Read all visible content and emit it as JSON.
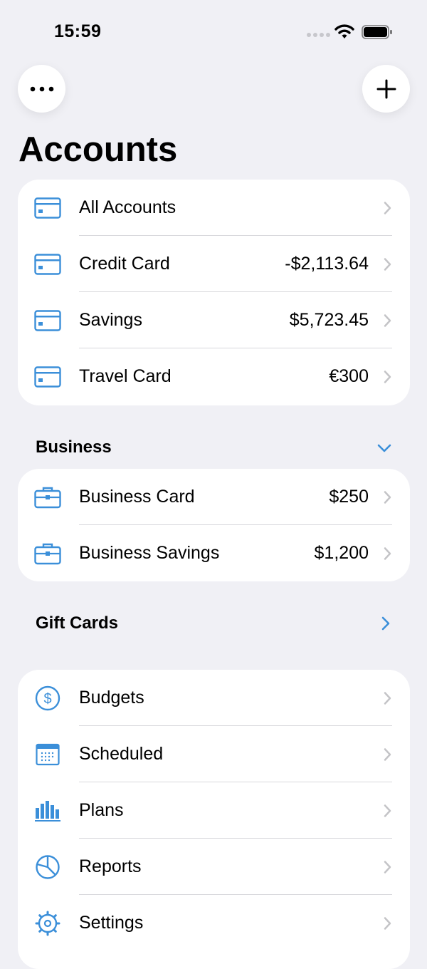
{
  "status_bar": {
    "time": "15:59"
  },
  "header": {
    "title": "Accounts"
  },
  "accounts": [
    {
      "label": "All Accounts",
      "value": "",
      "icon": "credit-card-icon"
    },
    {
      "label": "Credit Card",
      "value": "-$2,113.64",
      "icon": "credit-card-icon"
    },
    {
      "label": "Savings",
      "value": "$5,723.45",
      "icon": "credit-card-icon"
    },
    {
      "label": "Travel Card",
      "value": "€300",
      "icon": "credit-card-icon"
    }
  ],
  "business": {
    "title": "Business",
    "items": [
      {
        "label": "Business Card",
        "value": "$250",
        "icon": "briefcase-icon"
      },
      {
        "label": "Business Savings",
        "value": "$1,200",
        "icon": "briefcase-icon"
      }
    ]
  },
  "gift_cards": {
    "title": "Gift Cards"
  },
  "tools": [
    {
      "label": "Budgets",
      "icon": "dollar-circle-icon"
    },
    {
      "label": "Scheduled",
      "icon": "calendar-icon"
    },
    {
      "label": "Plans",
      "icon": "bar-chart-icon"
    },
    {
      "label": "Reports",
      "icon": "pie-chart-icon"
    },
    {
      "label": "Settings",
      "icon": "gear-icon"
    }
  ],
  "colors": {
    "accent": "#3b8fd9",
    "background": "#f0f0f5",
    "card": "#ffffff",
    "chevron": "#c4c4c7"
  }
}
